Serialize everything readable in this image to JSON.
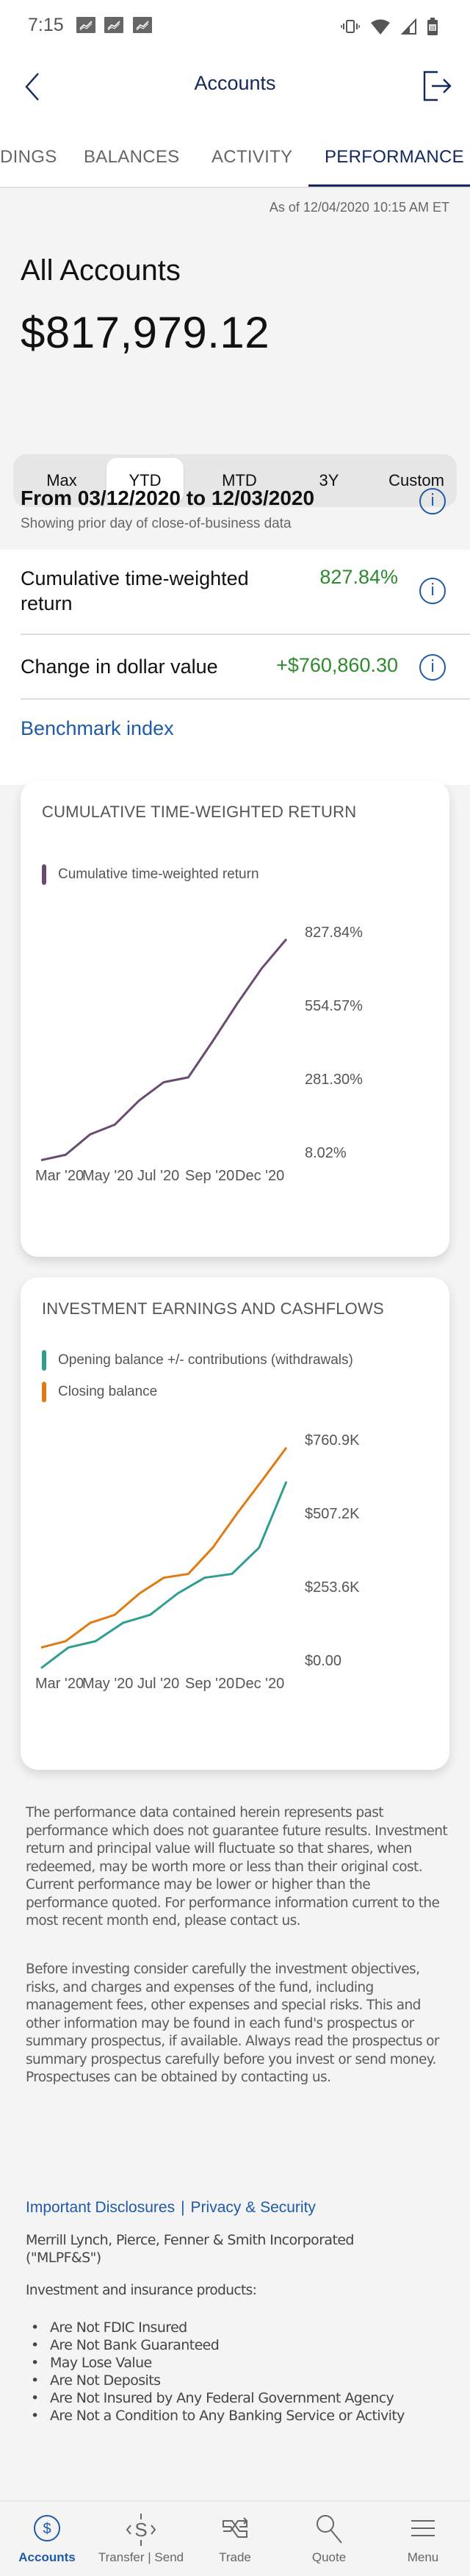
{
  "status_bar": {
    "time": "7:15",
    "battery": "23"
  },
  "header": {
    "title": "Accounts"
  },
  "tabs": [
    {
      "label": "HOLDINGS",
      "visible_label": "DINGS",
      "active": false
    },
    {
      "label": "BALANCES",
      "active": false
    },
    {
      "label": "ACTIVITY",
      "active": false
    },
    {
      "label": "PERFORMANCE",
      "active": true
    }
  ],
  "as_of": "As of 12/04/2020 10:15 AM ET",
  "account": {
    "title": "All Accounts",
    "value": "$817,979.12"
  },
  "range_selector": {
    "options": [
      "Max",
      "YTD",
      "MTD",
      "3Y",
      "Custom"
    ],
    "selected": "YTD"
  },
  "period": {
    "title": "From 03/12/2020 to 12/03/2020",
    "subtitle": "Showing prior day of close-of-business data"
  },
  "metrics": [
    {
      "label": "Cumulative time-weighted return",
      "value": "827.84%"
    },
    {
      "label": "Change in dollar value",
      "value": "+$760,860.30"
    }
  ],
  "benchmark_link": "Benchmark index",
  "colors": {
    "navy": "#12285a",
    "link_blue": "#1f5aa8",
    "positive_green": "#2d8a2d",
    "twr_line": "#6b4a72",
    "opening_line": "#2e9e8f",
    "closing_line": "#e07a12"
  },
  "chart_data": [
    {
      "type": "line",
      "title": "CUMULATIVE TIME-WEIGHTED RETURN",
      "legend": [
        {
          "name": "Cumulative time-weighted return",
          "color": "#6b4a72"
        }
      ],
      "x_tick_labels": [
        "Mar '20",
        "May '20",
        "Jul '20",
        "Sep '20",
        "Dec '20"
      ],
      "y_tick_labels": [
        "827.84%",
        "554.57%",
        "281.30%",
        "8.02%"
      ],
      "ylim": [
        8.02,
        827.84
      ],
      "ylabel_position": "right",
      "grid": false,
      "series": [
        {
          "name": "Cumulative time-weighted return",
          "color": "#6b4a72",
          "values": [
            -10,
            10,
            86,
            122,
            212,
            280,
            298,
            433,
            573,
            704,
            812
          ]
        }
      ]
    },
    {
      "type": "line",
      "title": "INVESTMENT EARNINGS AND CASHFLOWS",
      "legend": [
        {
          "name": "Opening balance +/- contributions (withdrawals)",
          "color": "#2e9e8f"
        },
        {
          "name": "Closing balance",
          "color": "#e07a12"
        }
      ],
      "x_tick_labels": [
        "Mar '20",
        "May '20",
        "Jul '20",
        "Sep '20",
        "Dec '20"
      ],
      "y_tick_labels": [
        "$760.9K",
        "$507.2K",
        "$253.6K",
        "$0.00"
      ],
      "ylim": [
        0,
        760.9
      ],
      "y_units": "thousands USD",
      "ylabel_position": "right",
      "grid": false,
      "series": [
        {
          "name": "Opening balance +/- contributions (withdrawals)",
          "color": "#2e9e8f",
          "values": [
            -17,
            54,
            76,
            139,
            167,
            240,
            295,
            308,
            399,
            627
          ]
        },
        {
          "name": "Closing balance",
          "color": "#e07a12",
          "values": [
            54,
            76,
            139,
            167,
            240,
            295,
            308,
            399,
            518,
            630,
            744
          ]
        }
      ]
    }
  ],
  "disclaimers": [
    "The performance data contained herein represents past performance which does not guarantee future results. Investment return and principal value will fluctuate so that shares, when redeemed, may be worth more or less than their original cost. Current performance may be lower or higher than the performance quoted. For performance information current to the most recent month end, please contact us.",
    "Before investing consider carefully the investment objectives, risks, and charges and expenses of the fund, including management fees, other expenses and special risks. This and other information may be found in each fund's prospectus or summary prospectus, if available. Always read the prospectus or summary prospectus carefully before you invest or send money. Prospectuses can be obtained by contacting us."
  ],
  "footer_links": {
    "disclosures": "Important Disclosures",
    "separator": "|",
    "privacy": "Privacy & Security"
  },
  "company": "Merrill Lynch, Pierce, Fenner & Smith Incorporated (\"MLPF&S\")",
  "products": {
    "title": "Investment and insurance products:",
    "items": [
      "Are Not FDIC Insured",
      "Are Not Bank Guaranteed",
      "May Lose Value",
      "Are Not Deposits",
      "Are Not Insured by Any Federal Government Agency",
      "Are Not a Condition to Any Banking Service or Activity"
    ]
  },
  "bottom_nav": [
    {
      "label": "Accounts",
      "icon": "dollar-circle-icon",
      "active": true
    },
    {
      "label": "Transfer | Send",
      "icon": "transfer-icon",
      "active": false
    },
    {
      "label": "Trade",
      "icon": "trade-icon",
      "active": false
    },
    {
      "label": "Quote",
      "icon": "search-icon",
      "active": false
    },
    {
      "label": "Menu",
      "icon": "menu-icon",
      "active": false
    }
  ]
}
